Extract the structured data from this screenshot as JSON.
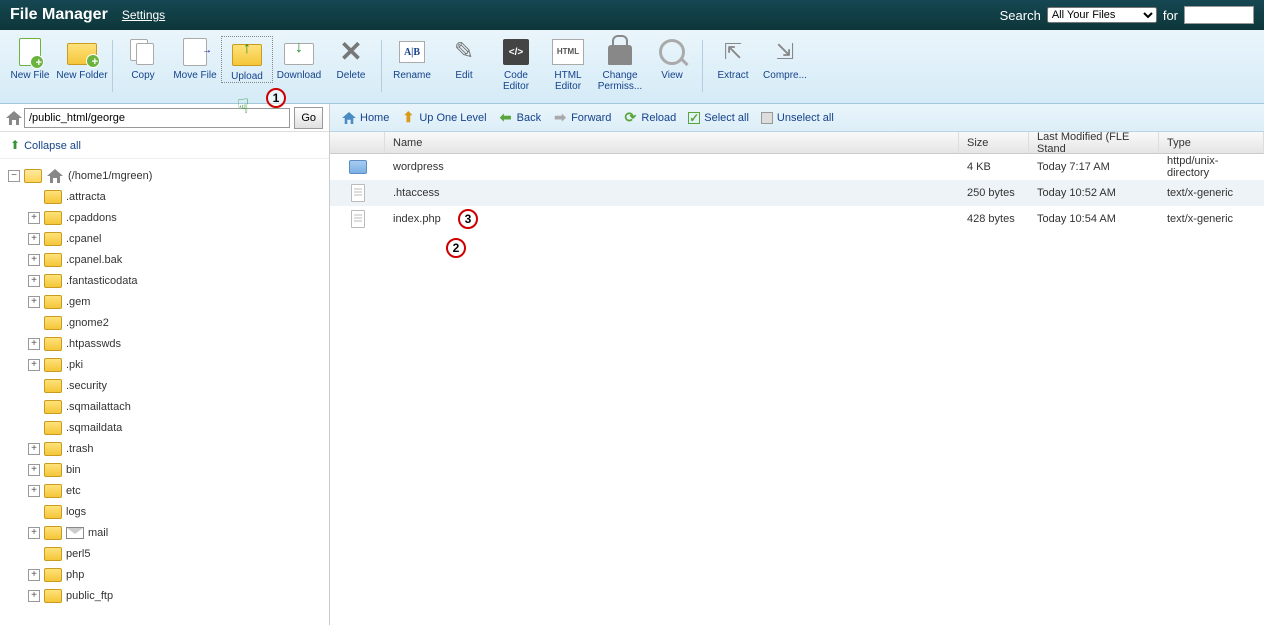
{
  "header": {
    "title": "File Manager",
    "settings": "Settings",
    "search_label": "Search",
    "search_scope": "All Your Files",
    "for_label": "for",
    "search_value": ""
  },
  "toolbar": [
    {
      "id": "new-file",
      "label": "New File"
    },
    {
      "id": "new-folder",
      "label": "New Folder"
    },
    {
      "id": "copy",
      "label": "Copy"
    },
    {
      "id": "move-file",
      "label": "Move File"
    },
    {
      "id": "upload",
      "label": "Upload"
    },
    {
      "id": "download",
      "label": "Download"
    },
    {
      "id": "delete",
      "label": "Delete"
    },
    {
      "id": "rename",
      "label": "Rename"
    },
    {
      "id": "edit",
      "label": "Edit"
    },
    {
      "id": "code-editor",
      "label": "Code Editor"
    },
    {
      "id": "html-editor",
      "label": "HTML Editor"
    },
    {
      "id": "change-perms",
      "label": "Change Permiss..."
    },
    {
      "id": "view",
      "label": "View"
    },
    {
      "id": "extract",
      "label": "Extract"
    },
    {
      "id": "compress",
      "label": "Compre..."
    }
  ],
  "annotations": {
    "a1": "1",
    "a2": "2",
    "a3": "3"
  },
  "path": {
    "value": "/public_html/george",
    "go": "Go"
  },
  "collapse": "Collapse all",
  "tree": {
    "root_label": "(/home1/mgreen)",
    "items": [
      {
        "label": ".attracta",
        "exp": "none"
      },
      {
        "label": ".cpaddons",
        "exp": "plus"
      },
      {
        "label": ".cpanel",
        "exp": "plus"
      },
      {
        "label": ".cpanel.bak",
        "exp": "plus"
      },
      {
        "label": ".fantasticodata",
        "exp": "plus"
      },
      {
        "label": ".gem",
        "exp": "plus"
      },
      {
        "label": ".gnome2",
        "exp": "none"
      },
      {
        "label": ".htpasswds",
        "exp": "plus"
      },
      {
        "label": ".pki",
        "exp": "plus"
      },
      {
        "label": ".security",
        "exp": "none"
      },
      {
        "label": ".sqmailattach",
        "exp": "none"
      },
      {
        "label": ".sqmaildata",
        "exp": "none"
      },
      {
        "label": ".trash",
        "exp": "plus"
      },
      {
        "label": "bin",
        "exp": "plus"
      },
      {
        "label": "etc",
        "exp": "plus"
      },
      {
        "label": "logs",
        "exp": "none"
      },
      {
        "label": "mail",
        "exp": "plus",
        "icon": "mail"
      },
      {
        "label": "perl5",
        "exp": "none"
      },
      {
        "label": "php",
        "exp": "plus"
      },
      {
        "label": "public_ftp",
        "exp": "plus"
      }
    ]
  },
  "actionbar": {
    "home": "Home",
    "up": "Up One Level",
    "back": "Back",
    "forward": "Forward",
    "reload": "Reload",
    "select_all": "Select all",
    "unselect_all": "Unselect all"
  },
  "columns": {
    "name": "Name",
    "size": "Size",
    "mod": "Last Modified (FLE Stand",
    "type": "Type"
  },
  "files": [
    {
      "icon": "folder",
      "name": "wordpress",
      "size": "4 KB",
      "mod": "Today 7:17 AM",
      "type": "httpd/unix-directory"
    },
    {
      "icon": "file",
      "name": ".htaccess",
      "size": "250 bytes",
      "mod": "Today 10:52 AM",
      "type": "text/x-generic",
      "hover": true
    },
    {
      "icon": "file",
      "name": "index.php",
      "size": "428 bytes",
      "mod": "Today 10:54 AM",
      "type": "text/x-generic"
    }
  ]
}
